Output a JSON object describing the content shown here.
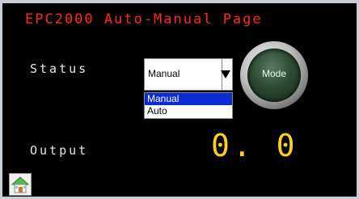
{
  "page": {
    "title": "EPC2000 Auto-Manual Page"
  },
  "status": {
    "label": "Status",
    "select_value": "Manual",
    "options": [
      "Manual",
      "Auto"
    ],
    "highlighted_option": "Manual"
  },
  "mode_button": {
    "label": "Mode"
  },
  "output": {
    "label": "Output",
    "value": "0. 0"
  },
  "icons": {
    "home": "home-icon",
    "dropdown_arrow": "chevron-down-icon"
  },
  "colors": {
    "title": "#ff2a1a",
    "label": "#e6e6e6",
    "output_value": "#ffd21f",
    "selection": "#0b2bd4",
    "panel": "#000000"
  }
}
